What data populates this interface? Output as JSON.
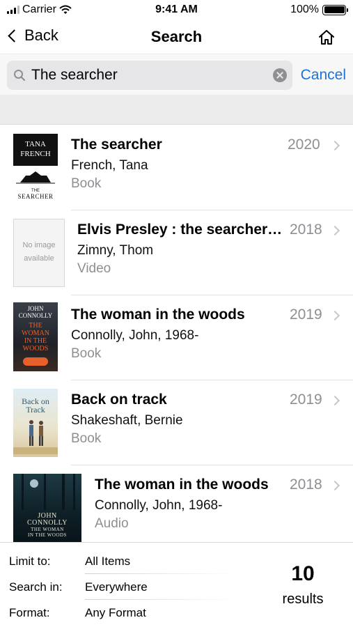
{
  "status_bar": {
    "carrier": "Carrier",
    "time": "9:41 AM",
    "battery": "100%",
    "battery_level": 1.0
  },
  "nav": {
    "back_label": "Back",
    "title": "Search",
    "home_icon": "home-icon"
  },
  "search": {
    "query": "The searcher",
    "placeholder": "Search",
    "cancel_label": "Cancel"
  },
  "results": [
    {
      "title": "The searcher",
      "author": "French, Tana",
      "format": "Book",
      "year": "2020",
      "cover": {
        "type": "image",
        "line1": "TANA",
        "line2": "FRENCH",
        "footer": "SEARCHER",
        "small": "THE"
      }
    },
    {
      "title": "Elvis Presley : the searcher (the...",
      "author": "Zimny, Thom",
      "format": "Video",
      "year": "2018",
      "cover": {
        "type": "placeholder",
        "line1": "No image",
        "line2": "available"
      }
    },
    {
      "title": "The woman in the woods",
      "author": "Connolly, John, 1968-",
      "format": "Book",
      "year": "2019",
      "cover": {
        "type": "image",
        "line1": "JOHN",
        "line2": "CONNOLLY",
        "line3": "THE",
        "line4": "WOMAN",
        "line5": "IN THE",
        "line6": "WOODS"
      }
    },
    {
      "title": "Back on track",
      "author": "Shakeshaft, Bernie",
      "format": "Book",
      "year": "2019",
      "cover": {
        "type": "image",
        "line1": "Back on",
        "line2": "Track"
      }
    },
    {
      "title": "The woman in the woods",
      "author": "Connolly, John, 1968-",
      "format": "Audio",
      "year": "2018",
      "cover": {
        "type": "image",
        "line1": "JOHN",
        "line2": "CONNOLLY",
        "line3": "THE WOMAN",
        "line4": "IN THE WOODS"
      }
    }
  ],
  "filters": {
    "limit_label": "Limit to:",
    "limit_value": "All Items",
    "search_in_label": "Search in:",
    "search_in_value": "Everywhere",
    "format_label": "Format:",
    "format_value": "Any Format"
  },
  "count": {
    "value": "10",
    "label": "results"
  },
  "colors": {
    "accent": "#1a73d9",
    "secondary_text": "#8e8e93",
    "separator": "#e2e2e2",
    "section_bg": "#ececec"
  }
}
